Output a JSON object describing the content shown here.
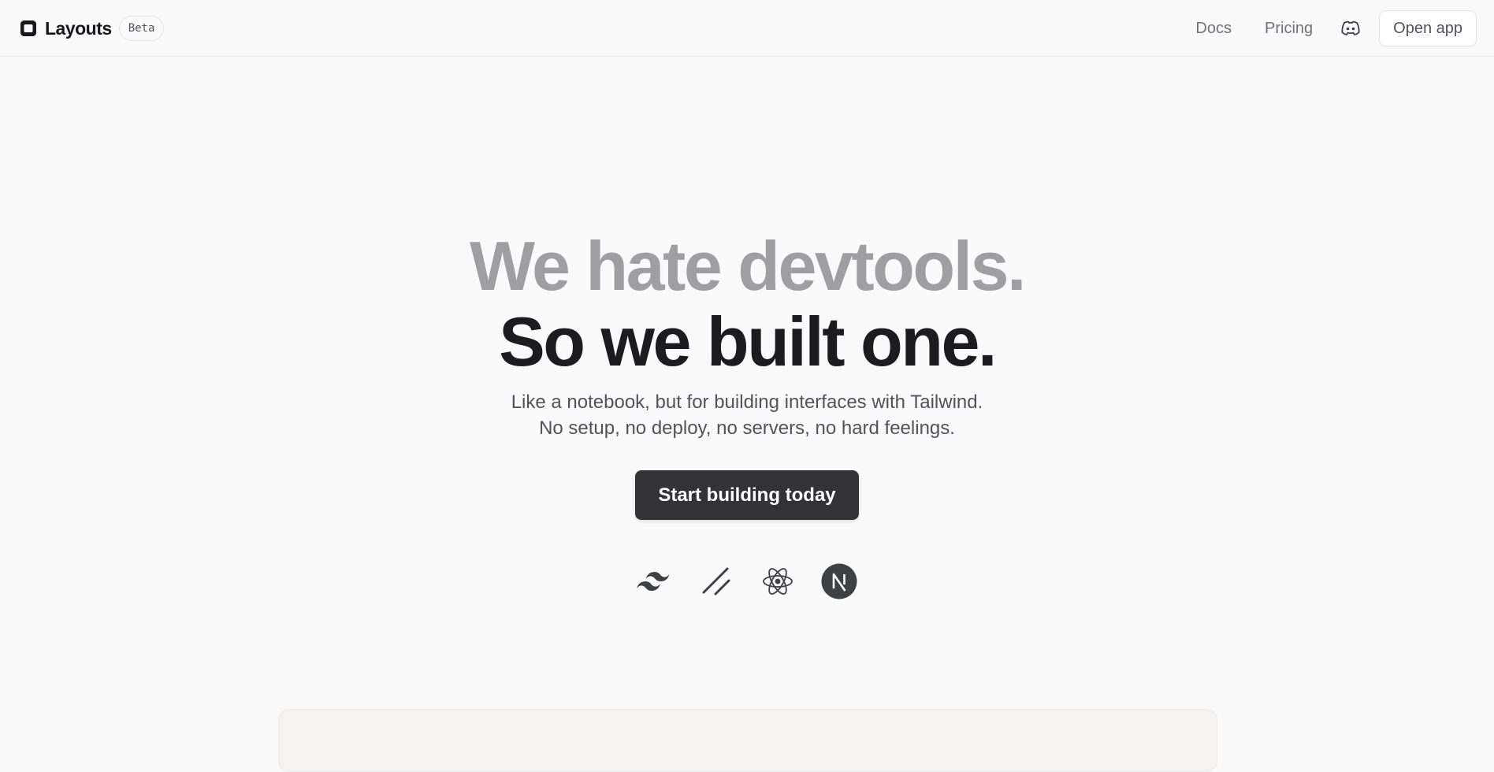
{
  "header": {
    "brand_name": "Layouts",
    "badge": "Beta",
    "logo_icon": "square-logo-icon",
    "nav": {
      "docs": "Docs",
      "pricing": "Pricing",
      "discord_icon": "discord-icon",
      "open_app": "Open app"
    }
  },
  "hero": {
    "headline_line1": "We hate devtools.",
    "headline_line2": "So we built one.",
    "subtitle_line1": "Like a notebook, but for building interfaces with Tailwind.",
    "subtitle_line2": "No setup, no deploy, no servers, no hard feelings.",
    "cta_label": "Start building today",
    "tech_icons": [
      "tailwind-icon",
      "shadcn-icon",
      "react-icon",
      "nextjs-icon"
    ]
  },
  "colors": {
    "background": "#fafafa",
    "headline_muted": "#9f9fa2",
    "headline_dark": "#1c1c1f",
    "cta_background": "#333336",
    "preview_panel": "#f4f3f2"
  }
}
